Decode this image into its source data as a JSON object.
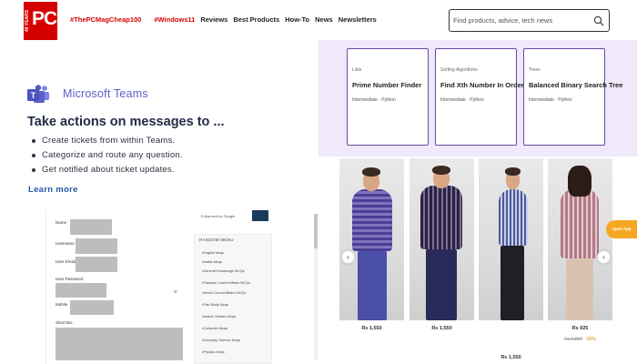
{
  "header": {
    "logo_text": "PC",
    "logo_badge": "40 YEARS",
    "nav": {
      "tag1": "#ThePCMagCheap100",
      "tag2": "#Windows11",
      "reviews": "Reviews",
      "best": "Best Products",
      "howto": "How-To",
      "news": "News",
      "newsletters": "Newsletters"
    },
    "search_placeholder": "Find products, advice, tech news",
    "search_icon": "search-icon"
  },
  "teams_ad": {
    "brand": "Microsoft Teams",
    "headline": "Take actions on messages to ...",
    "bullets": [
      "Create tickets from within Teams.",
      "Categorize and route any question.",
      "Get notified about ticket updates."
    ],
    "cta": "Learn more"
  },
  "form_preview": {
    "labels": {
      "name": "Name",
      "username": "Username",
      "email": "User Email",
      "password": "User Password",
      "mobile": "Mobile",
      "bio": "Short Bio"
    },
    "side_top_text": "Enhanced by Google",
    "side_title": "RANDOM MENU",
    "side_items": [
      "English Mcqs",
      "Maths Mcqs",
      "General Knowledge MCQs",
      "Pakistan Current Affairs MCQs",
      "World Current Affairs MCQs",
      "Pak Study Mcqs",
      "Islamic Studies Mcqs",
      "Computer Mcqs",
      "Everyday Science Mcqs",
      "Physics Mcqs"
    ]
  },
  "practice_cards": [
    {
      "topic": "Lists",
      "title": "Prime Number Finder",
      "meta": "Intermediate · Python"
    },
    {
      "topic": "Sorting Algorithms",
      "title": "Find Xth Number In Order",
      "meta": "Intermediate · Python"
    },
    {
      "topic": "Trees",
      "title": "Balanced Binary Search Tree",
      "meta": "Intermediate · Python"
    }
  ],
  "products": [
    {
      "price": "Rs 1,550",
      "sub_old": "",
      "sub_off": ""
    },
    {
      "price": "Rs 1,550",
      "sub_old": "",
      "sub_off": ""
    },
    {
      "price": "Rs 1,550",
      "sub_old": "",
      "sub_off": ""
    },
    {
      "price": "Rs 925",
      "sub_old": "Rs 1,850",
      "sub_off": "-50%"
    }
  ],
  "carousel": {
    "prev_icon": "chevron-left-icon",
    "next_icon": "chevron-right-icon"
  },
  "open_app": "Open App",
  "colors": {
    "brand_red": "#d50000",
    "teams_purple": "#5b5fc7",
    "card_border": "#6b4aa0",
    "card_panel": "#efe9fb",
    "link_blue": "#2557a7",
    "open_app": "#f5a623"
  }
}
